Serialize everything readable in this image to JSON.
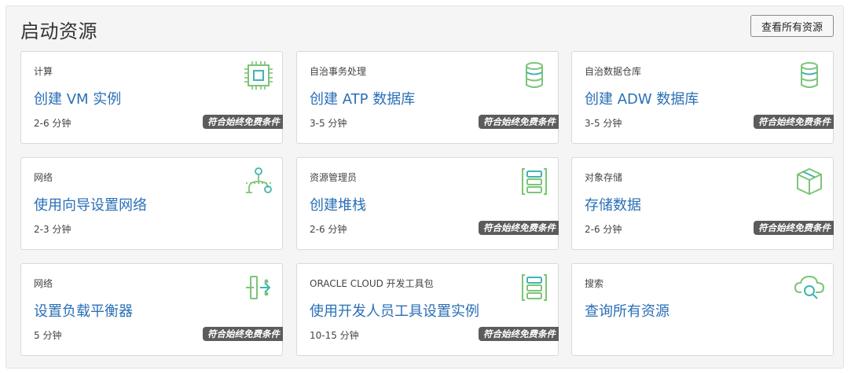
{
  "header": {
    "title": "启动资源",
    "view_all_label": "查看所有资源"
  },
  "free_badge_label": "符合始终免费条件",
  "cards": [
    {
      "category": "计算",
      "action": "创建 VM 实例",
      "duration": "2-6 分钟",
      "free": true,
      "icon": "chip-icon"
    },
    {
      "category": "自治事务处理",
      "action": "创建 ATP 数据库",
      "duration": "3-5 分钟",
      "free": true,
      "icon": "database-icon"
    },
    {
      "category": "自治数据仓库",
      "action": "创建 ADW 数据库",
      "duration": "3-5 分钟",
      "free": true,
      "icon": "database-icon"
    },
    {
      "category": "网络",
      "action": "使用向导设置网络",
      "duration": "2-3 分钟",
      "free": false,
      "icon": "network-icon"
    },
    {
      "category": "资源管理员",
      "action": "创建堆栈",
      "duration": "2-6 分钟",
      "free": true,
      "icon": "stack-icon"
    },
    {
      "category": "对象存储",
      "action": "存储数据",
      "duration": "2-6 分钟",
      "free": true,
      "icon": "cube-icon"
    },
    {
      "category": "网络",
      "action": "设置负载平衡器",
      "duration": "5 分钟",
      "free": true,
      "icon": "load-balancer-icon"
    },
    {
      "category": "ORACLE CLOUD 开发工具包",
      "action": "使用开发人员工具设置实例",
      "duration": "10-15 分钟",
      "free": true,
      "icon": "stack-icon"
    },
    {
      "category": "搜索",
      "action": "查询所有资源",
      "duration": "",
      "free": false,
      "icon": "cloud-search-icon"
    }
  ],
  "colors": {
    "link": "#2a6fb6",
    "icon_green": "#7cc576",
    "icon_teal": "#3fb6b0",
    "badge_bg": "#5c5c5c"
  }
}
